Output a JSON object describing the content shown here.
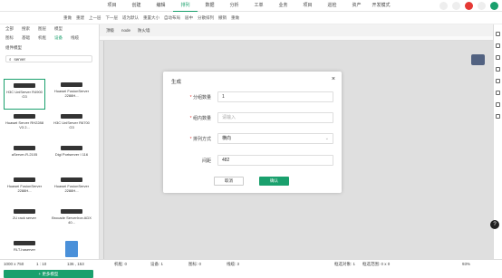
{
  "menu": [
    "项目",
    "创建",
    "编辑",
    "排列",
    "数据",
    "分析",
    "工单",
    "业务",
    "项目",
    "巡检",
    "资产",
    "开发模式"
  ],
  "menu_active_index": 3,
  "toolbar": [
    "重做",
    "重建",
    "上一层",
    "下一层",
    "适为默认",
    "重置大小",
    "自动布局",
    "居中",
    "分散排列",
    "撤销",
    "重做"
  ],
  "sidebar": {
    "tabs1": [
      "全部",
      "搜索",
      "图层",
      "模型"
    ],
    "tabs2": [
      "图标",
      "基础",
      "机框",
      "设备",
      "线缆"
    ],
    "section_title": "组件模型",
    "search_value": "server",
    "devices": [
      "H3C UniServer R4900 G3",
      "Huawei FusionServer 2288H...",
      "Huawei Server RH2288 V3 2...",
      "H3C UniServer R6700 G3",
      "aServer-R-2105",
      "Digi Portserver I 116",
      "Huawei FusionServer 2288H...",
      "Huawei FusionServer 2288H...",
      "2U rack server",
      "Brocade ServerIron ADX 40...",
      "RLT-haserver",
      "server"
    ],
    "more_button": "+ 更多模型"
  },
  "breadcrumb": [
    "顶级",
    "node",
    "防火墙"
  ],
  "modal": {
    "title": "生成",
    "fields": [
      {
        "label": "分组数量",
        "required": true,
        "value": "1",
        "placeholder": ""
      },
      {
        "label": "组内数量",
        "required": true,
        "value": "",
        "placeholder": "请输入"
      },
      {
        "label": "排列方式",
        "required": true,
        "value": "横向",
        "placeholder": ""
      },
      {
        "label": "间距",
        "required": false,
        "value": "482",
        "placeholder": ""
      }
    ],
    "cancel": "取消",
    "ok": "确认"
  },
  "status": {
    "size": "1000 x 750",
    "zoom_ratio": "1 : 10",
    "coords": "136 , 153",
    "machines": "机框: 0",
    "devices": "设备: 1",
    "icons": "图标: 0",
    "cables": "线缆: 3",
    "sel_count": "框选对象: 1",
    "sel_range": "框选范围: 0 x 0",
    "zoom": "93%"
  },
  "colors": {
    "accent": "#1aa06d"
  }
}
